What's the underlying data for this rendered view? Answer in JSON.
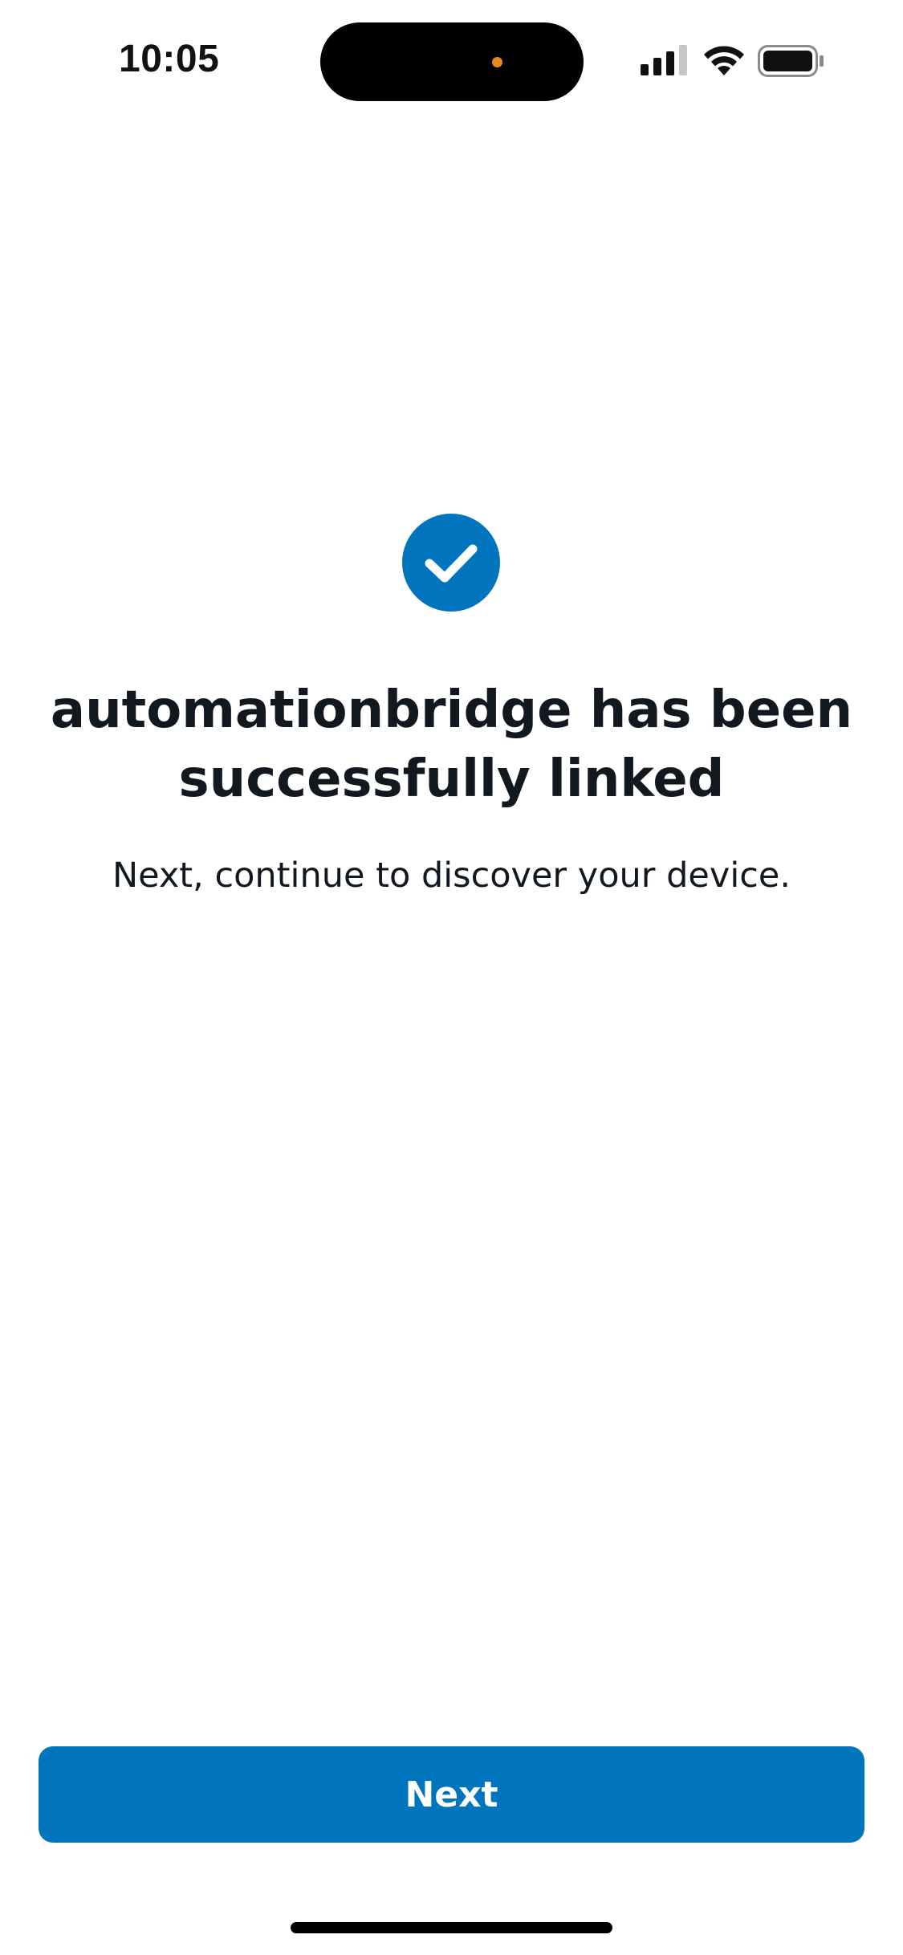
{
  "status_bar": {
    "time": "10:05",
    "icons": [
      "signal-icon",
      "wifi-icon",
      "battery-icon"
    ]
  },
  "main": {
    "icon": "check-circle-icon",
    "headline": "automationbridge has been successfully linked",
    "subtext": "Next, continue to discover your device."
  },
  "footer": {
    "next_label": "Next"
  },
  "colors": {
    "accent": "#0075be",
    "text": "#111820",
    "background": "#ffffff"
  }
}
